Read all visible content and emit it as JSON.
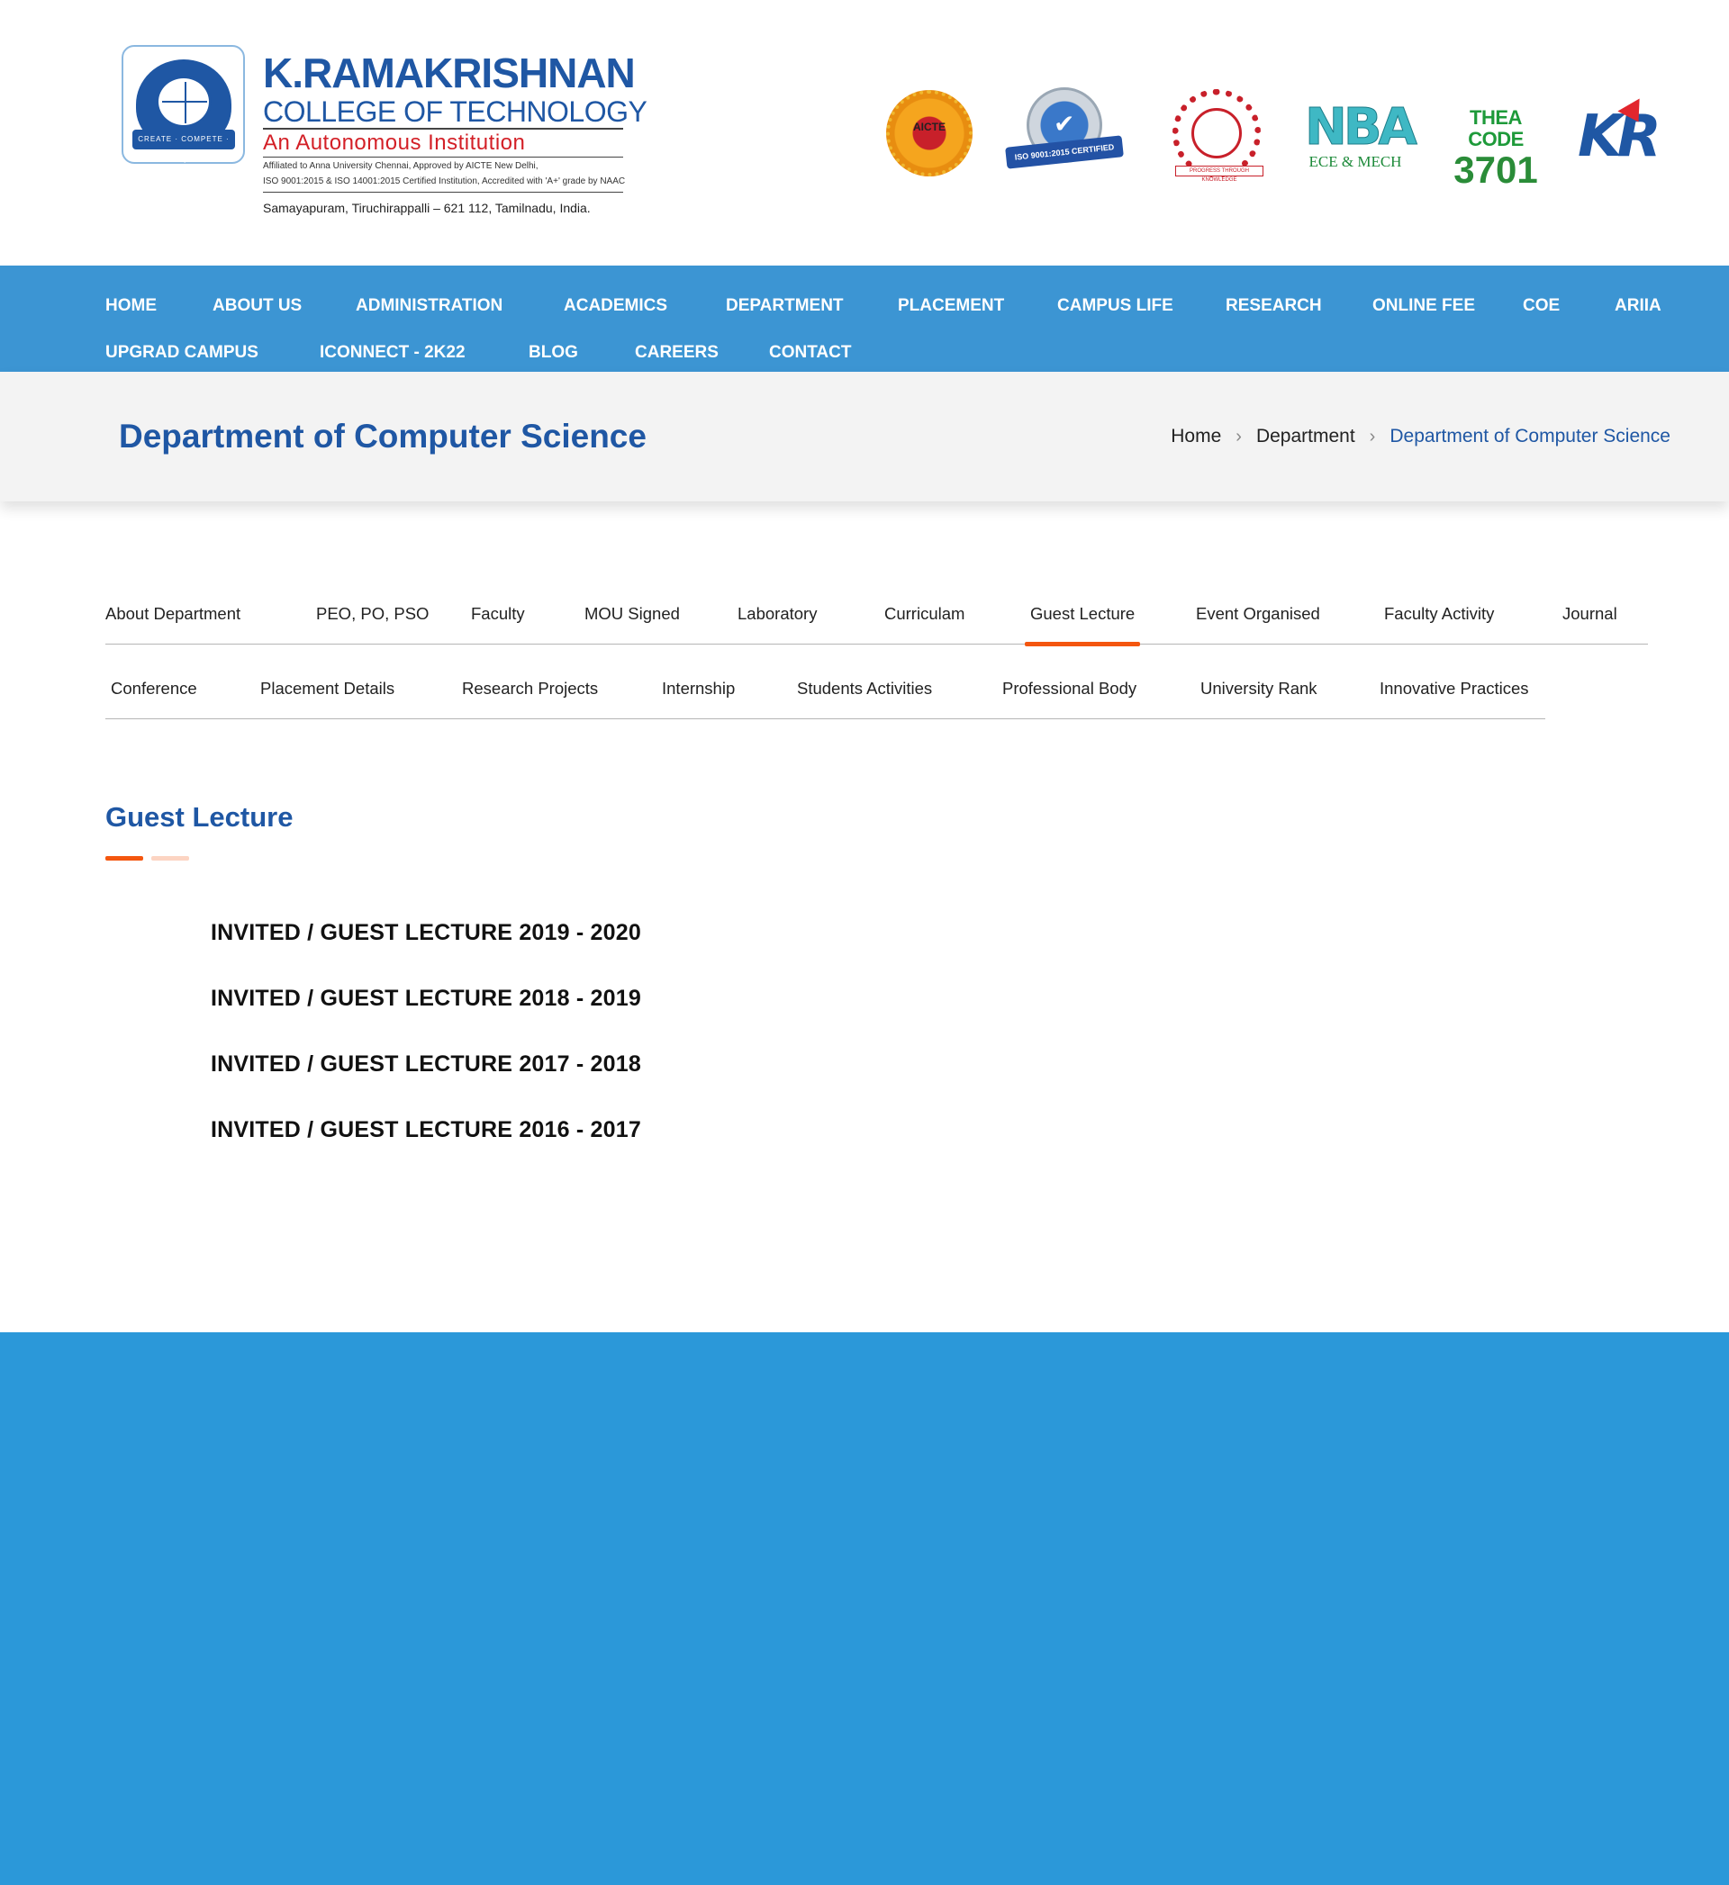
{
  "header": {
    "college_name": "K.RAMAKRISHNAN",
    "college_sub": "COLLEGE OF TECHNOLOGY",
    "autonomous": "An Autonomous Institution",
    "affiliation_1": "Affiliated to Anna University Chennai, Approved by AICTE New Delhi,",
    "affiliation_2": "ISO 9001:2015 & ISO 14001:2015 Certified Institution, Accredited with 'A+' grade by NAAC",
    "address": "Samayapuram, Tiruchirappalli – 621 112, Tamilnadu, India.",
    "emblem_motto": "CREATE · COMPETE · CONQUER",
    "badges": {
      "aicte": "AICTE",
      "iso": "ISO 9001:2015 CERTIFIED",
      "anna_tag": "PROGRESS THROUGH KNOWLEDGE",
      "nba": "NBA",
      "nba_sub": "ECE & MECH",
      "thea_label": "THEA CODE",
      "thea_code": "3701",
      "kr": "KR"
    }
  },
  "nav": {
    "items": [
      "HOME",
      "ABOUT US",
      "ADMINISTRATION",
      "ACADEMICS",
      "DEPARTMENT",
      "PLACEMENT",
      "CAMPUS LIFE",
      "RESEARCH",
      "ONLINE FEE",
      "COE",
      "ARIIA",
      "UPGRAD CAMPUS",
      "ICONNECT - 2K22",
      "BLOG",
      "CAREERS",
      "CONTACT"
    ]
  },
  "page": {
    "title": "Department of Computer Science",
    "breadcrumb": [
      "Home",
      "Department",
      "Department of Computer Science"
    ]
  },
  "tabs": {
    "row1": [
      "About Department",
      "PEO, PO, PSO",
      "Faculty",
      "MOU Signed",
      "Laboratory",
      "Curriculam",
      "Guest Lecture",
      "Event Organised",
      "Faculty Activity",
      "Journal"
    ],
    "row2": [
      "Conference",
      "Placement Details",
      "Research Projects",
      "Internship",
      "Students Activities",
      "Professional Body",
      "University Rank",
      "Innovative Practices"
    ],
    "active": "Guest Lecture"
  },
  "section": {
    "title": "Guest Lecture",
    "lectures": [
      "INVITED / GUEST LECTURE 2019 - 2020",
      "INVITED / GUEST LECTURE 2018 - 2019",
      "INVITED / GUEST LECTURE 2017 - 2018",
      "INVITED / GUEST LECTURE 2016 - 2017"
    ]
  },
  "colors": {
    "brand_blue": "#1f57a4",
    "nav_blue": "#3c95d3",
    "accent_orange": "#f4560f",
    "footer_blue": "#2b98d9"
  }
}
